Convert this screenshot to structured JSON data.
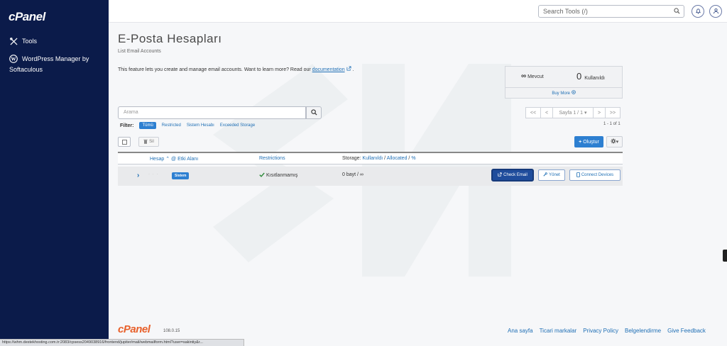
{
  "sidebar": {
    "logo": "cPanel",
    "items": [
      {
        "label": "Tools",
        "icon": "tools-icon"
      },
      {
        "label": "WordPress Manager by",
        "label2": "Softaculous",
        "icon": "wordpress-icon"
      }
    ]
  },
  "topbar": {
    "search_placeholder": "Search Tools (/)"
  },
  "page": {
    "title": "E-Posta Hesapları",
    "subtitle": "List Email Accounts",
    "feature_text": "This feature lets you create and manage email accounts. Want to learn more? Read our",
    "doc_link": "documentation",
    "doc_suffix": "."
  },
  "stats": {
    "available_symbol": "∞",
    "available_label": "Mevcut",
    "used_count": "0",
    "used_label": "Kullanıldı",
    "buy_more": "Buy More"
  },
  "search": {
    "placeholder": "Arama"
  },
  "pagination": {
    "first": "<<",
    "prev": "<",
    "page_label": "Sayfa 1 / 1",
    "next": ">",
    "last": ">>",
    "count": "1 - 1 of 1"
  },
  "filter": {
    "label": "Filter:",
    "options": [
      "Tümü",
      "Restricted",
      "Sistem Hesabı",
      "Exceeded Storage"
    ]
  },
  "actions": {
    "delete_label": "Sil",
    "create_label": "Oluştur"
  },
  "table": {
    "headers": {
      "account": "Hesap",
      "domain": "@ Etki Alanı",
      "restrictions": "Restrictions",
      "storage_prefix": "Storage:",
      "storage_used": "Kullanıldı",
      "storage_allocated": "Allocated",
      "storage_pct": "%"
    },
    "rows": [
      {
        "badge": "Sistem",
        "restriction": "Kısıtlanmamış",
        "storage": "0 bayt / ∞",
        "check_email": "Check Email",
        "manage": "Yönet",
        "connect": "Connect Devices"
      }
    ]
  },
  "footer": {
    "logo": "cPanel",
    "version": "108.0.15",
    "links": [
      "Ana sayfa",
      "Ticari markalar",
      "Privacy Policy",
      "Belgelendirme",
      "Give Feedback"
    ]
  },
  "status_bar": {
    "url": "https://whm.destekhosting.com.tr:2083/cpsess2049038916/frontend/jupiter/mail/webmailform.html?user=sakintiy&r..."
  },
  "colors": {
    "sidebar_bg": "#0b1b4a",
    "accent": "#2d7fd1",
    "link": "#1f6fb5",
    "brand_orange": "#e8612c"
  }
}
